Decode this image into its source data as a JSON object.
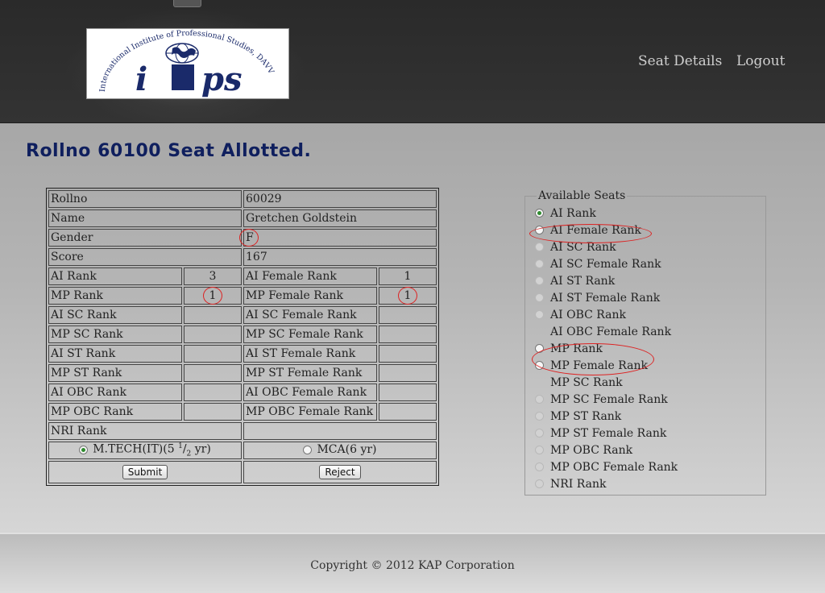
{
  "header": {
    "logo": {
      "arc_text": "International Institute of Professional Studies, DAVV",
      "wordmark_left": "i",
      "wordmark_right": "ps"
    },
    "nav": {
      "seat_details": "Seat Details",
      "logout": "Logout"
    }
  },
  "page_title": "Rollno 60100 Seat Allotted.",
  "student": {
    "rollno_label": "Rollno",
    "rollno": "60029",
    "name_label": "Name",
    "name": "Gretchen Goldstein",
    "gender_label": "Gender",
    "gender": "F",
    "score_label": "Score",
    "score": "167",
    "ranks": [
      {
        "l1": "AI Rank",
        "v1": "3",
        "l2": "AI Female Rank",
        "v2": "1"
      },
      {
        "l1": "MP Rank",
        "v1": "1",
        "l2": "MP Female Rank",
        "v2": "1"
      },
      {
        "l1": "AI SC Rank",
        "v1": "",
        "l2": "AI SC Female Rank",
        "v2": ""
      },
      {
        "l1": "MP SC Rank",
        "v1": "",
        "l2": "MP SC Female Rank",
        "v2": ""
      },
      {
        "l1": "AI ST Rank",
        "v1": "",
        "l2": "AI ST Female Rank",
        "v2": ""
      },
      {
        "l1": "MP ST Rank",
        "v1": "",
        "l2": "MP ST Female Rank",
        "v2": ""
      },
      {
        "l1": "AI OBC Rank",
        "v1": "",
        "l2": "AI OBC Female Rank",
        "v2": ""
      },
      {
        "l1": "MP OBC Rank",
        "v1": "",
        "l2": "MP OBC Female Rank",
        "v2": ""
      }
    ],
    "nri_label": "NRI Rank",
    "nri": ""
  },
  "course": {
    "opt1": "M.TECH(IT)(5 ",
    "opt1_sup": "1",
    "opt1_sub": "2",
    "opt1_end": " yr)",
    "opt2": "MCA(6 yr)",
    "selected": "opt1"
  },
  "buttons": {
    "submit": "Submit",
    "reject": "Reject"
  },
  "seats": {
    "legend": "Available Seats",
    "options": [
      {
        "label": "AI Rank",
        "state": "checked"
      },
      {
        "label": "AI Female Rank",
        "state": "enabled"
      },
      {
        "label": "AI SC Rank",
        "state": "disabled"
      },
      {
        "label": "AI SC Female Rank",
        "state": "disabled"
      },
      {
        "label": "AI ST Rank",
        "state": "disabled"
      },
      {
        "label": "AI ST Female Rank",
        "state": "disabled"
      },
      {
        "label": "AI OBC Rank",
        "state": "disabled"
      },
      {
        "label": "AI OBC Female Rank",
        "state": "none"
      },
      {
        "label": "MP Rank",
        "state": "enabled"
      },
      {
        "label": "MP Female Rank",
        "state": "enabled"
      },
      {
        "label": "MP SC Rank",
        "state": "none"
      },
      {
        "label": "MP SC Female Rank",
        "state": "disabled"
      },
      {
        "label": "MP ST Rank",
        "state": "disabled"
      },
      {
        "label": "MP ST Female Rank",
        "state": "disabled"
      },
      {
        "label": "MP OBC Rank",
        "state": "disabled"
      },
      {
        "label": "MP OBC Female Rank",
        "state": "disabled"
      },
      {
        "label": "NRI Rank",
        "state": "disabled"
      }
    ]
  },
  "footer": {
    "copyright": "Copyright © 2012 KAP Corporation"
  },
  "colors": {
    "title": "#0f1f5e",
    "annotation": "#dd2222",
    "header_bg": "#2f2f2f"
  }
}
